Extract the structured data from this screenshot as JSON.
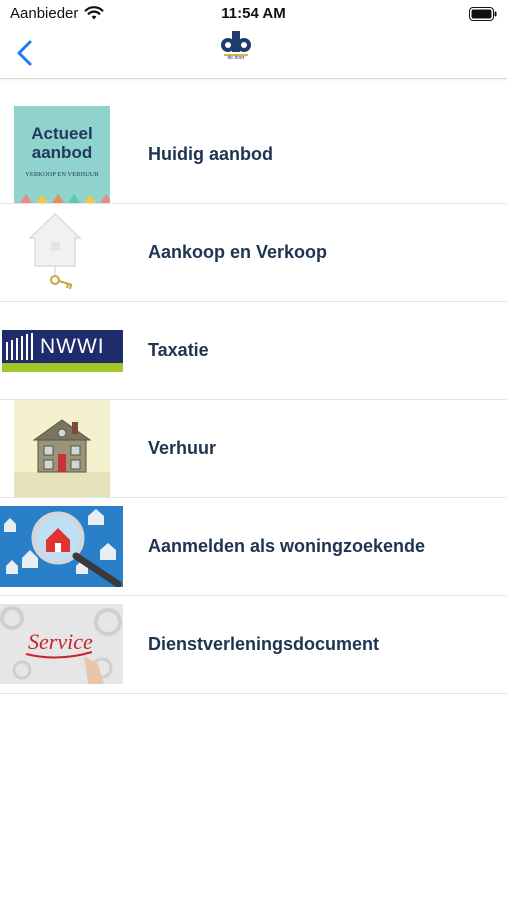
{
  "status": {
    "carrier": "Aanbieder",
    "time": "11:54 AM"
  },
  "nav": {
    "logo_text": "de boer"
  },
  "thumbs": {
    "actueel_line1": "Actueel",
    "actueel_line2": "aanbod",
    "actueel_sub": "VERKOOP EN VERHUUR",
    "nwwi": "NWWI",
    "service": "Service"
  },
  "menu": [
    {
      "label": "Huidig aanbod"
    },
    {
      "label": "Aankoop en Verkoop"
    },
    {
      "label": "Taxatie"
    },
    {
      "label": "Verhuur"
    },
    {
      "label": "Aanmelden als woningzoekende"
    },
    {
      "label": "Dienstverleningsdocument"
    }
  ],
  "colors": {
    "accent": "#1a7ef0",
    "label": "#1e3450",
    "divider": "#e4e4e4"
  }
}
